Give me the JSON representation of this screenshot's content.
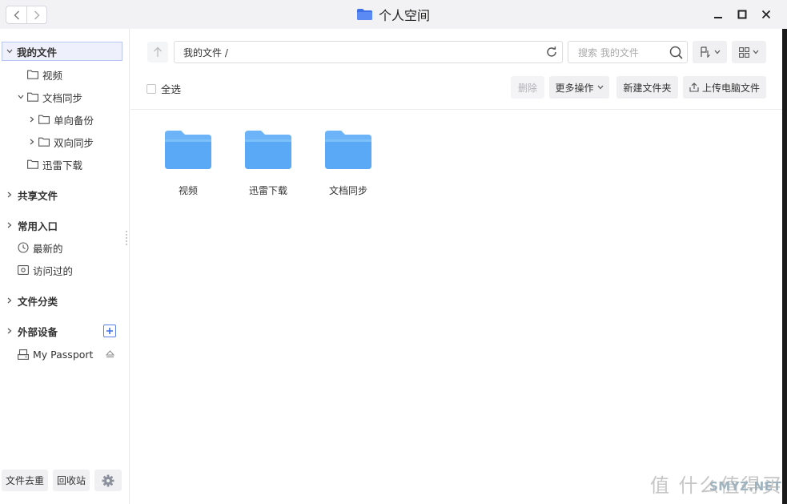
{
  "window": {
    "title": "个人空间",
    "colors": {
      "accent": "#3d6fe8",
      "folder": "#5aa9f6",
      "titlebar": "#f2f2f4"
    }
  },
  "sidebar": {
    "my_files": "我的文件",
    "my_files_children": [
      "视频",
      "文档同步",
      "单向备份",
      "双向同步",
      "迅雷下载"
    ],
    "shared": "共享文件",
    "common": "常用入口",
    "recent": "最新的",
    "visited": "访问过的",
    "categories": "文件分类",
    "external": "外部设备",
    "device": "My Passport",
    "dedupe": "文件去重",
    "recycle": "回收站"
  },
  "toolbar": {
    "path": "我的文件 /",
    "search_placeholder": "搜索 我的文件",
    "select_all": "全选",
    "delete": "删除",
    "more": "更多操作",
    "new_folder": "新建文件夹",
    "upload": "上传电脑文件"
  },
  "folders": [
    {
      "name": "视频"
    },
    {
      "name": "迅雷下载"
    },
    {
      "name": "文档同步"
    }
  ],
  "watermark": {
    "main": "值 什么值得买",
    "sub": "SMYZ.NET"
  }
}
